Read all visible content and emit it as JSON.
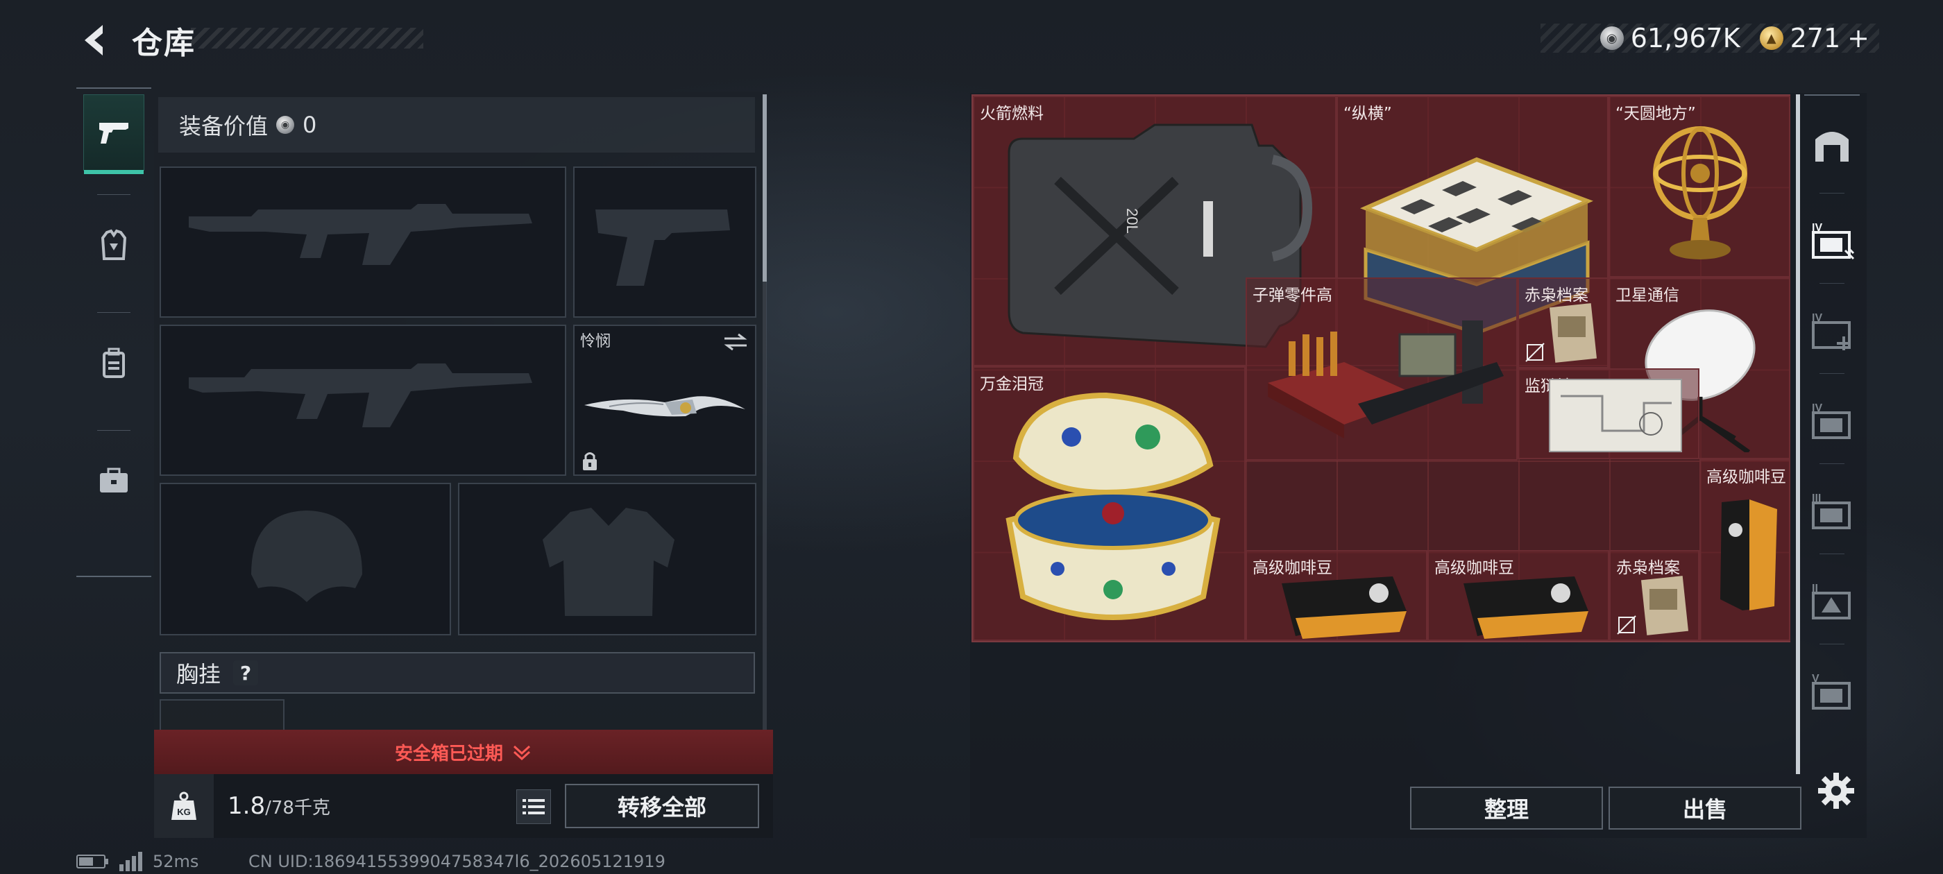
{
  "header": {
    "title": "仓库",
    "currency_silver": "61,967K",
    "currency_gold": "271",
    "gold_plus": "+"
  },
  "equipment": {
    "value_label": "装备价值",
    "value": "0",
    "knife_label": "怜悯",
    "vest_label": "胸挂",
    "vest_help": "?",
    "expired_text": "安全箱已过期",
    "weight_current": "1.8",
    "weight_max": "/78千克",
    "weight_icon_text": "KG",
    "transfer_all": "转移全部"
  },
  "status": {
    "ping": "52ms",
    "uid": "CN UID:1869415539904758347l6_202605121919"
  },
  "storage": {
    "items": [
      {
        "label": "火箭燃料"
      },
      {
        "label": "“纵横”"
      },
      {
        "label": "“天圆地方”"
      },
      {
        "label": "卫星通信"
      },
      {
        "label": "万金泪冠"
      },
      {
        "label": "子弹零件高"
      },
      {
        "label": "赤枭档案"
      },
      {
        "label": "监狱地图"
      },
      {
        "label": "高级咖啡豆"
      },
      {
        "label": "高级咖啡豆"
      },
      {
        "label": "高级咖啡豆"
      },
      {
        "label": "赤枭档案"
      }
    ],
    "right_tabs": [
      "IV",
      "IV",
      "IV",
      "III",
      "II",
      "V"
    ],
    "sort_label": "整理",
    "sell_label": "出售"
  },
  "colors": {
    "accent_teal": "#3ec4a8",
    "grid_red": "#4b1f24",
    "expired_red": "#ff5a55"
  }
}
